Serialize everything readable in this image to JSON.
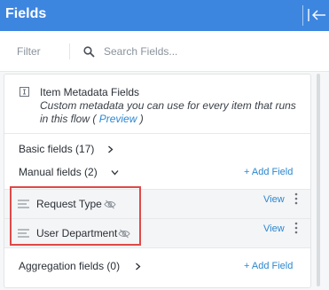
{
  "header": {
    "title": "Fields",
    "collapse_icon": "collapse-panel-icon"
  },
  "filter": {
    "label": "Filter",
    "search_placeholder": "Search Fields...",
    "search_value": ""
  },
  "metadata": {
    "title": "Item Metadata Fields",
    "description": "Custom metadata you can use for every item that runs in this flow ( ",
    "link": "Preview",
    "suffix": " )"
  },
  "sections": {
    "basic": {
      "label": "Basic fields (17)"
    },
    "manual": {
      "label": "Manual fields (2)",
      "add_label": "+ Add Field"
    },
    "aggregation": {
      "label": "Aggregation fields (0)",
      "add_label": "+ Add Field"
    }
  },
  "manual_fields": [
    {
      "name": "Request Type",
      "view_label": "View"
    },
    {
      "name": "User Department",
      "view_label": "View"
    }
  ],
  "colors": {
    "header": "#3d86e0",
    "accent": "#2b87d0",
    "highlight": "#e04848"
  }
}
